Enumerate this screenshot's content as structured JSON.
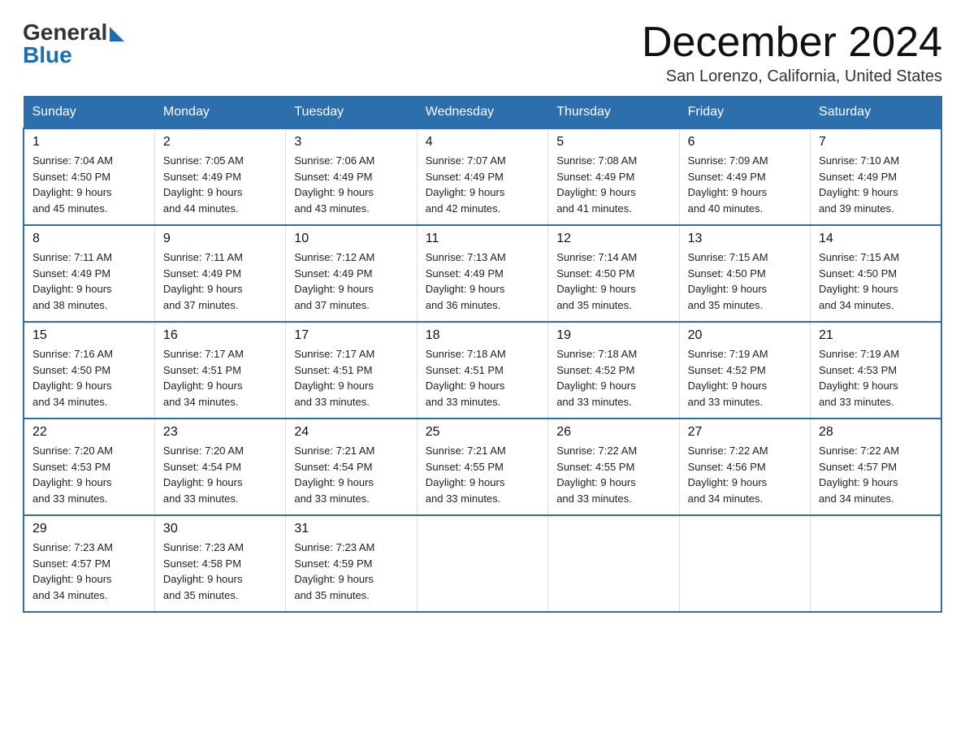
{
  "header": {
    "logo_general": "General",
    "logo_blue": "Blue",
    "month_title": "December 2024",
    "location": "San Lorenzo, California, United States"
  },
  "weekdays": [
    "Sunday",
    "Monday",
    "Tuesday",
    "Wednesday",
    "Thursday",
    "Friday",
    "Saturday"
  ],
  "weeks": [
    [
      {
        "day": "1",
        "sunrise": "Sunrise: 7:04 AM",
        "sunset": "Sunset: 4:50 PM",
        "daylight": "Daylight: 9 hours",
        "daylight2": "and 45 minutes."
      },
      {
        "day": "2",
        "sunrise": "Sunrise: 7:05 AM",
        "sunset": "Sunset: 4:49 PM",
        "daylight": "Daylight: 9 hours",
        "daylight2": "and 44 minutes."
      },
      {
        "day": "3",
        "sunrise": "Sunrise: 7:06 AM",
        "sunset": "Sunset: 4:49 PM",
        "daylight": "Daylight: 9 hours",
        "daylight2": "and 43 minutes."
      },
      {
        "day": "4",
        "sunrise": "Sunrise: 7:07 AM",
        "sunset": "Sunset: 4:49 PM",
        "daylight": "Daylight: 9 hours",
        "daylight2": "and 42 minutes."
      },
      {
        "day": "5",
        "sunrise": "Sunrise: 7:08 AM",
        "sunset": "Sunset: 4:49 PM",
        "daylight": "Daylight: 9 hours",
        "daylight2": "and 41 minutes."
      },
      {
        "day": "6",
        "sunrise": "Sunrise: 7:09 AM",
        "sunset": "Sunset: 4:49 PM",
        "daylight": "Daylight: 9 hours",
        "daylight2": "and 40 minutes."
      },
      {
        "day": "7",
        "sunrise": "Sunrise: 7:10 AM",
        "sunset": "Sunset: 4:49 PM",
        "daylight": "Daylight: 9 hours",
        "daylight2": "and 39 minutes."
      }
    ],
    [
      {
        "day": "8",
        "sunrise": "Sunrise: 7:11 AM",
        "sunset": "Sunset: 4:49 PM",
        "daylight": "Daylight: 9 hours",
        "daylight2": "and 38 minutes."
      },
      {
        "day": "9",
        "sunrise": "Sunrise: 7:11 AM",
        "sunset": "Sunset: 4:49 PM",
        "daylight": "Daylight: 9 hours",
        "daylight2": "and 37 minutes."
      },
      {
        "day": "10",
        "sunrise": "Sunrise: 7:12 AM",
        "sunset": "Sunset: 4:49 PM",
        "daylight": "Daylight: 9 hours",
        "daylight2": "and 37 minutes."
      },
      {
        "day": "11",
        "sunrise": "Sunrise: 7:13 AM",
        "sunset": "Sunset: 4:49 PM",
        "daylight": "Daylight: 9 hours",
        "daylight2": "and 36 minutes."
      },
      {
        "day": "12",
        "sunrise": "Sunrise: 7:14 AM",
        "sunset": "Sunset: 4:50 PM",
        "daylight": "Daylight: 9 hours",
        "daylight2": "and 35 minutes."
      },
      {
        "day": "13",
        "sunrise": "Sunrise: 7:15 AM",
        "sunset": "Sunset: 4:50 PM",
        "daylight": "Daylight: 9 hours",
        "daylight2": "and 35 minutes."
      },
      {
        "day": "14",
        "sunrise": "Sunrise: 7:15 AM",
        "sunset": "Sunset: 4:50 PM",
        "daylight": "Daylight: 9 hours",
        "daylight2": "and 34 minutes."
      }
    ],
    [
      {
        "day": "15",
        "sunrise": "Sunrise: 7:16 AM",
        "sunset": "Sunset: 4:50 PM",
        "daylight": "Daylight: 9 hours",
        "daylight2": "and 34 minutes."
      },
      {
        "day": "16",
        "sunrise": "Sunrise: 7:17 AM",
        "sunset": "Sunset: 4:51 PM",
        "daylight": "Daylight: 9 hours",
        "daylight2": "and 34 minutes."
      },
      {
        "day": "17",
        "sunrise": "Sunrise: 7:17 AM",
        "sunset": "Sunset: 4:51 PM",
        "daylight": "Daylight: 9 hours",
        "daylight2": "and 33 minutes."
      },
      {
        "day": "18",
        "sunrise": "Sunrise: 7:18 AM",
        "sunset": "Sunset: 4:51 PM",
        "daylight": "Daylight: 9 hours",
        "daylight2": "and 33 minutes."
      },
      {
        "day": "19",
        "sunrise": "Sunrise: 7:18 AM",
        "sunset": "Sunset: 4:52 PM",
        "daylight": "Daylight: 9 hours",
        "daylight2": "and 33 minutes."
      },
      {
        "day": "20",
        "sunrise": "Sunrise: 7:19 AM",
        "sunset": "Sunset: 4:52 PM",
        "daylight": "Daylight: 9 hours",
        "daylight2": "and 33 minutes."
      },
      {
        "day": "21",
        "sunrise": "Sunrise: 7:19 AM",
        "sunset": "Sunset: 4:53 PM",
        "daylight": "Daylight: 9 hours",
        "daylight2": "and 33 minutes."
      }
    ],
    [
      {
        "day": "22",
        "sunrise": "Sunrise: 7:20 AM",
        "sunset": "Sunset: 4:53 PM",
        "daylight": "Daylight: 9 hours",
        "daylight2": "and 33 minutes."
      },
      {
        "day": "23",
        "sunrise": "Sunrise: 7:20 AM",
        "sunset": "Sunset: 4:54 PM",
        "daylight": "Daylight: 9 hours",
        "daylight2": "and 33 minutes."
      },
      {
        "day": "24",
        "sunrise": "Sunrise: 7:21 AM",
        "sunset": "Sunset: 4:54 PM",
        "daylight": "Daylight: 9 hours",
        "daylight2": "and 33 minutes."
      },
      {
        "day": "25",
        "sunrise": "Sunrise: 7:21 AM",
        "sunset": "Sunset: 4:55 PM",
        "daylight": "Daylight: 9 hours",
        "daylight2": "and 33 minutes."
      },
      {
        "day": "26",
        "sunrise": "Sunrise: 7:22 AM",
        "sunset": "Sunset: 4:55 PM",
        "daylight": "Daylight: 9 hours",
        "daylight2": "and 33 minutes."
      },
      {
        "day": "27",
        "sunrise": "Sunrise: 7:22 AM",
        "sunset": "Sunset: 4:56 PM",
        "daylight": "Daylight: 9 hours",
        "daylight2": "and 34 minutes."
      },
      {
        "day": "28",
        "sunrise": "Sunrise: 7:22 AM",
        "sunset": "Sunset: 4:57 PM",
        "daylight": "Daylight: 9 hours",
        "daylight2": "and 34 minutes."
      }
    ],
    [
      {
        "day": "29",
        "sunrise": "Sunrise: 7:23 AM",
        "sunset": "Sunset: 4:57 PM",
        "daylight": "Daylight: 9 hours",
        "daylight2": "and 34 minutes."
      },
      {
        "day": "30",
        "sunrise": "Sunrise: 7:23 AM",
        "sunset": "Sunset: 4:58 PM",
        "daylight": "Daylight: 9 hours",
        "daylight2": "and 35 minutes."
      },
      {
        "day": "31",
        "sunrise": "Sunrise: 7:23 AM",
        "sunset": "Sunset: 4:59 PM",
        "daylight": "Daylight: 9 hours",
        "daylight2": "and 35 minutes."
      },
      null,
      null,
      null,
      null
    ]
  ]
}
